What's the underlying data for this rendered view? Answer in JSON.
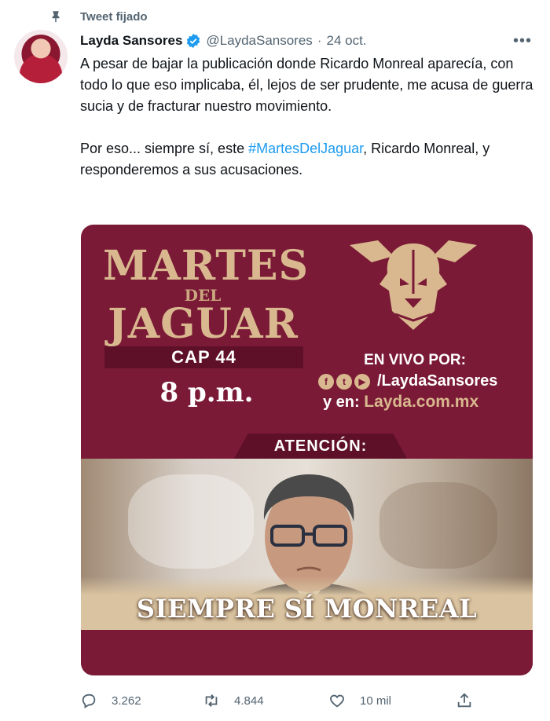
{
  "pinned_label": "Tweet fijado",
  "tweet": {
    "author_name": "Layda Sansores",
    "handle": "@LaydaSansores",
    "separator": "·",
    "date": "24 oct.",
    "paragraph1": "A pesar de bajar la publicación donde Ricardo Monreal aparecía, con todo lo que eso implicaba, él, lejos de ser prudente, me acusa de guerra sucia y de fracturar nuestro movimiento.",
    "paragraph2_before": "Por eso... siempre sí, este ",
    "hashtag": "#MartesDelJaguar",
    "paragraph2_after": ", Ricardo Monreal, y responderemos a sus acusaciones."
  },
  "image": {
    "title_line1": "MARTES",
    "title_line2": "DEL",
    "title_line3": "JAGUAR",
    "chapter": "CAP 44",
    "time": "8 p.m.",
    "live_label": "EN VIVO POR:",
    "social_handle": "/LaydaSansores",
    "web_prefix": "y en: ",
    "web_url": "Layda.com.mx",
    "attention": "ATENCIÓN:",
    "banner": "SIEMPRE SÍ MONREAL"
  },
  "actions": {
    "replies": "3.262",
    "retweets": "4.844",
    "likes": "10 mil"
  },
  "colors": {
    "accent": "#1d9bf0",
    "card_bg": "#7a1a36",
    "gold": "#d9b88f",
    "muted": "#536471"
  }
}
